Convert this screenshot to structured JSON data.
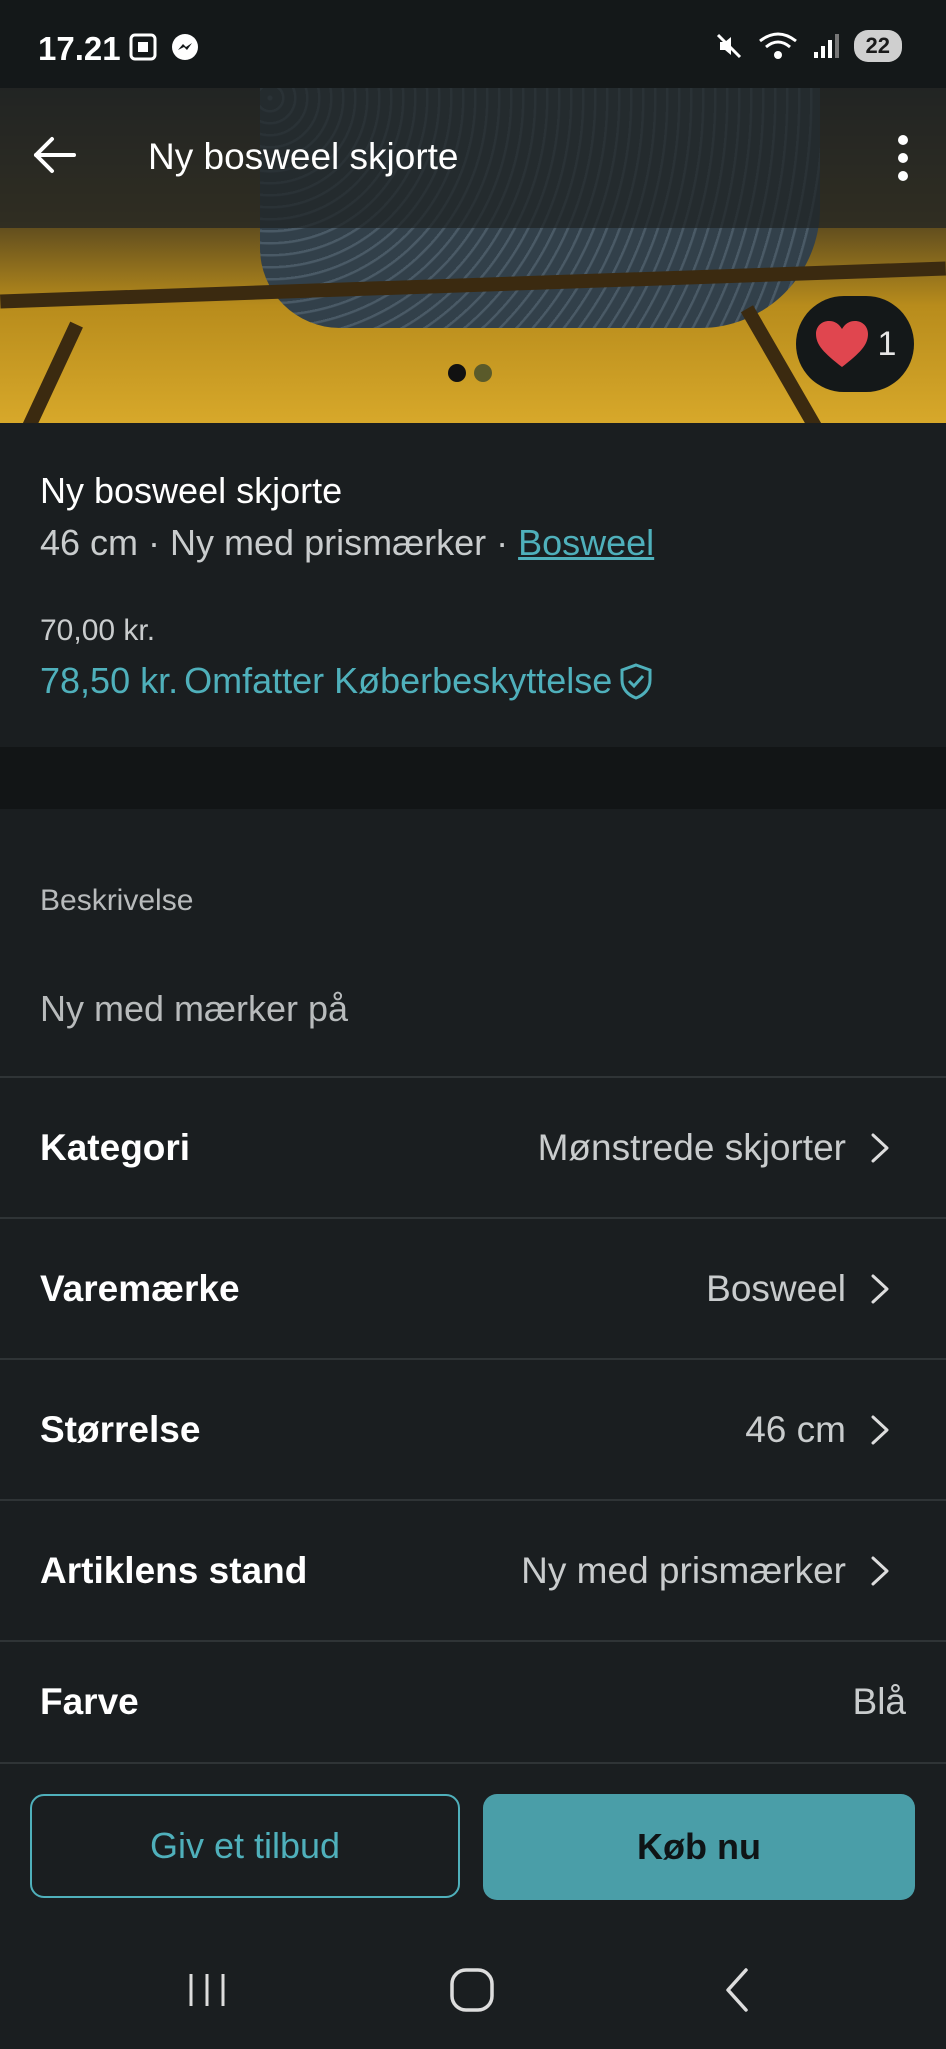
{
  "status_bar": {
    "time": "17.21",
    "battery": "22",
    "icons": [
      "screenshot-icon",
      "messenger-icon",
      "mute-icon",
      "wifi-icon",
      "signal-icon"
    ]
  },
  "header": {
    "title": "Ny bosweel skjorte",
    "back_icon": "arrow-left-icon",
    "menu_icon": "more-vertical-icon"
  },
  "gallery": {
    "image_count": 2,
    "active_index": 0,
    "favorite_count": "1"
  },
  "item": {
    "title": "Ny bosweel skjorte",
    "size": "46 cm",
    "separator": " · ",
    "condition": "Ny med prismærker",
    "brand": "Bosweel",
    "price": "70,00 kr.",
    "total_price": "78,50 kr.",
    "protection_label": "Omfatter Køberbeskyttelse"
  },
  "description": {
    "label": "Beskrivelse",
    "text": "Ny med mærker på"
  },
  "details": [
    {
      "label": "Kategori",
      "value": "Mønstrede skjorter"
    },
    {
      "label": "Varemærke",
      "value": "Bosweel"
    },
    {
      "label": "Størrelse",
      "value": "46 cm"
    },
    {
      "label": "Artiklens stand",
      "value": "Ny med prismærker"
    },
    {
      "label": "Farve",
      "value": "Blå"
    }
  ],
  "actions": {
    "offer_label": "Giv et tilbud",
    "buy_label": "Køb nu"
  },
  "colors": {
    "accent": "#4fb0bb",
    "buy_button": "#4a9ea8",
    "background": "#1a1e20",
    "heart": "#e0464f"
  }
}
